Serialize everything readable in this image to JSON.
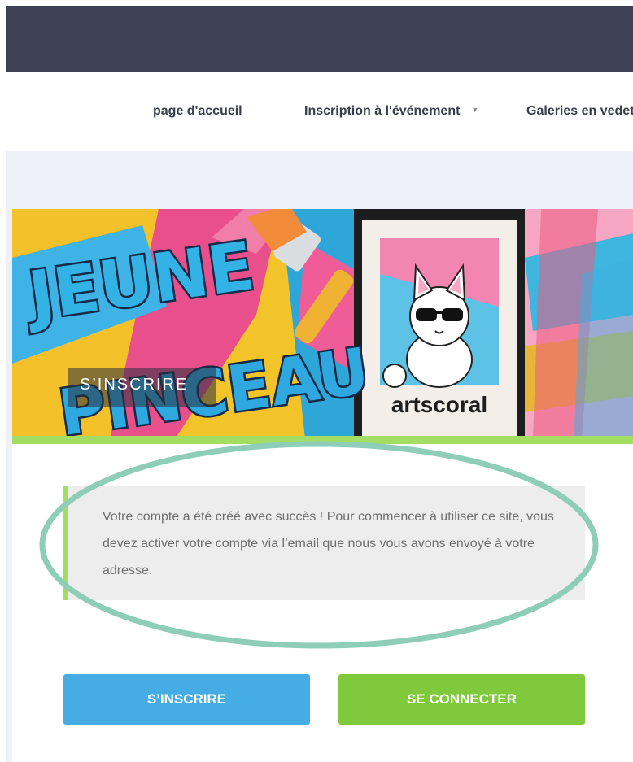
{
  "nav": {
    "items": [
      {
        "label": "page d'accueil"
      },
      {
        "label": "Inscription à l'événement",
        "caret": "▼"
      },
      {
        "label": "Galeries en vedette"
      }
    ]
  },
  "banner": {
    "heading": "S’INSCRIRE",
    "logo_text": "artscoral",
    "title_line1": "JEUNE",
    "title_line2": "PINCEAU"
  },
  "notice": {
    "message": "Votre compte a été créé avec succès ! Pour commencer à utiliser ce site, vous devez activer votre compte via l’email que nous vous avons envoyé à votre adresse."
  },
  "buttons": {
    "register_label": "S’INSCRIRE",
    "login_label": "SE CONNECTER"
  },
  "colors": {
    "topbar": "#3e4055",
    "accent_green": "#a4dd63",
    "button_blue": "#45ade4",
    "button_green": "#81c93c",
    "highlight_ring": "#8ecdb8"
  }
}
